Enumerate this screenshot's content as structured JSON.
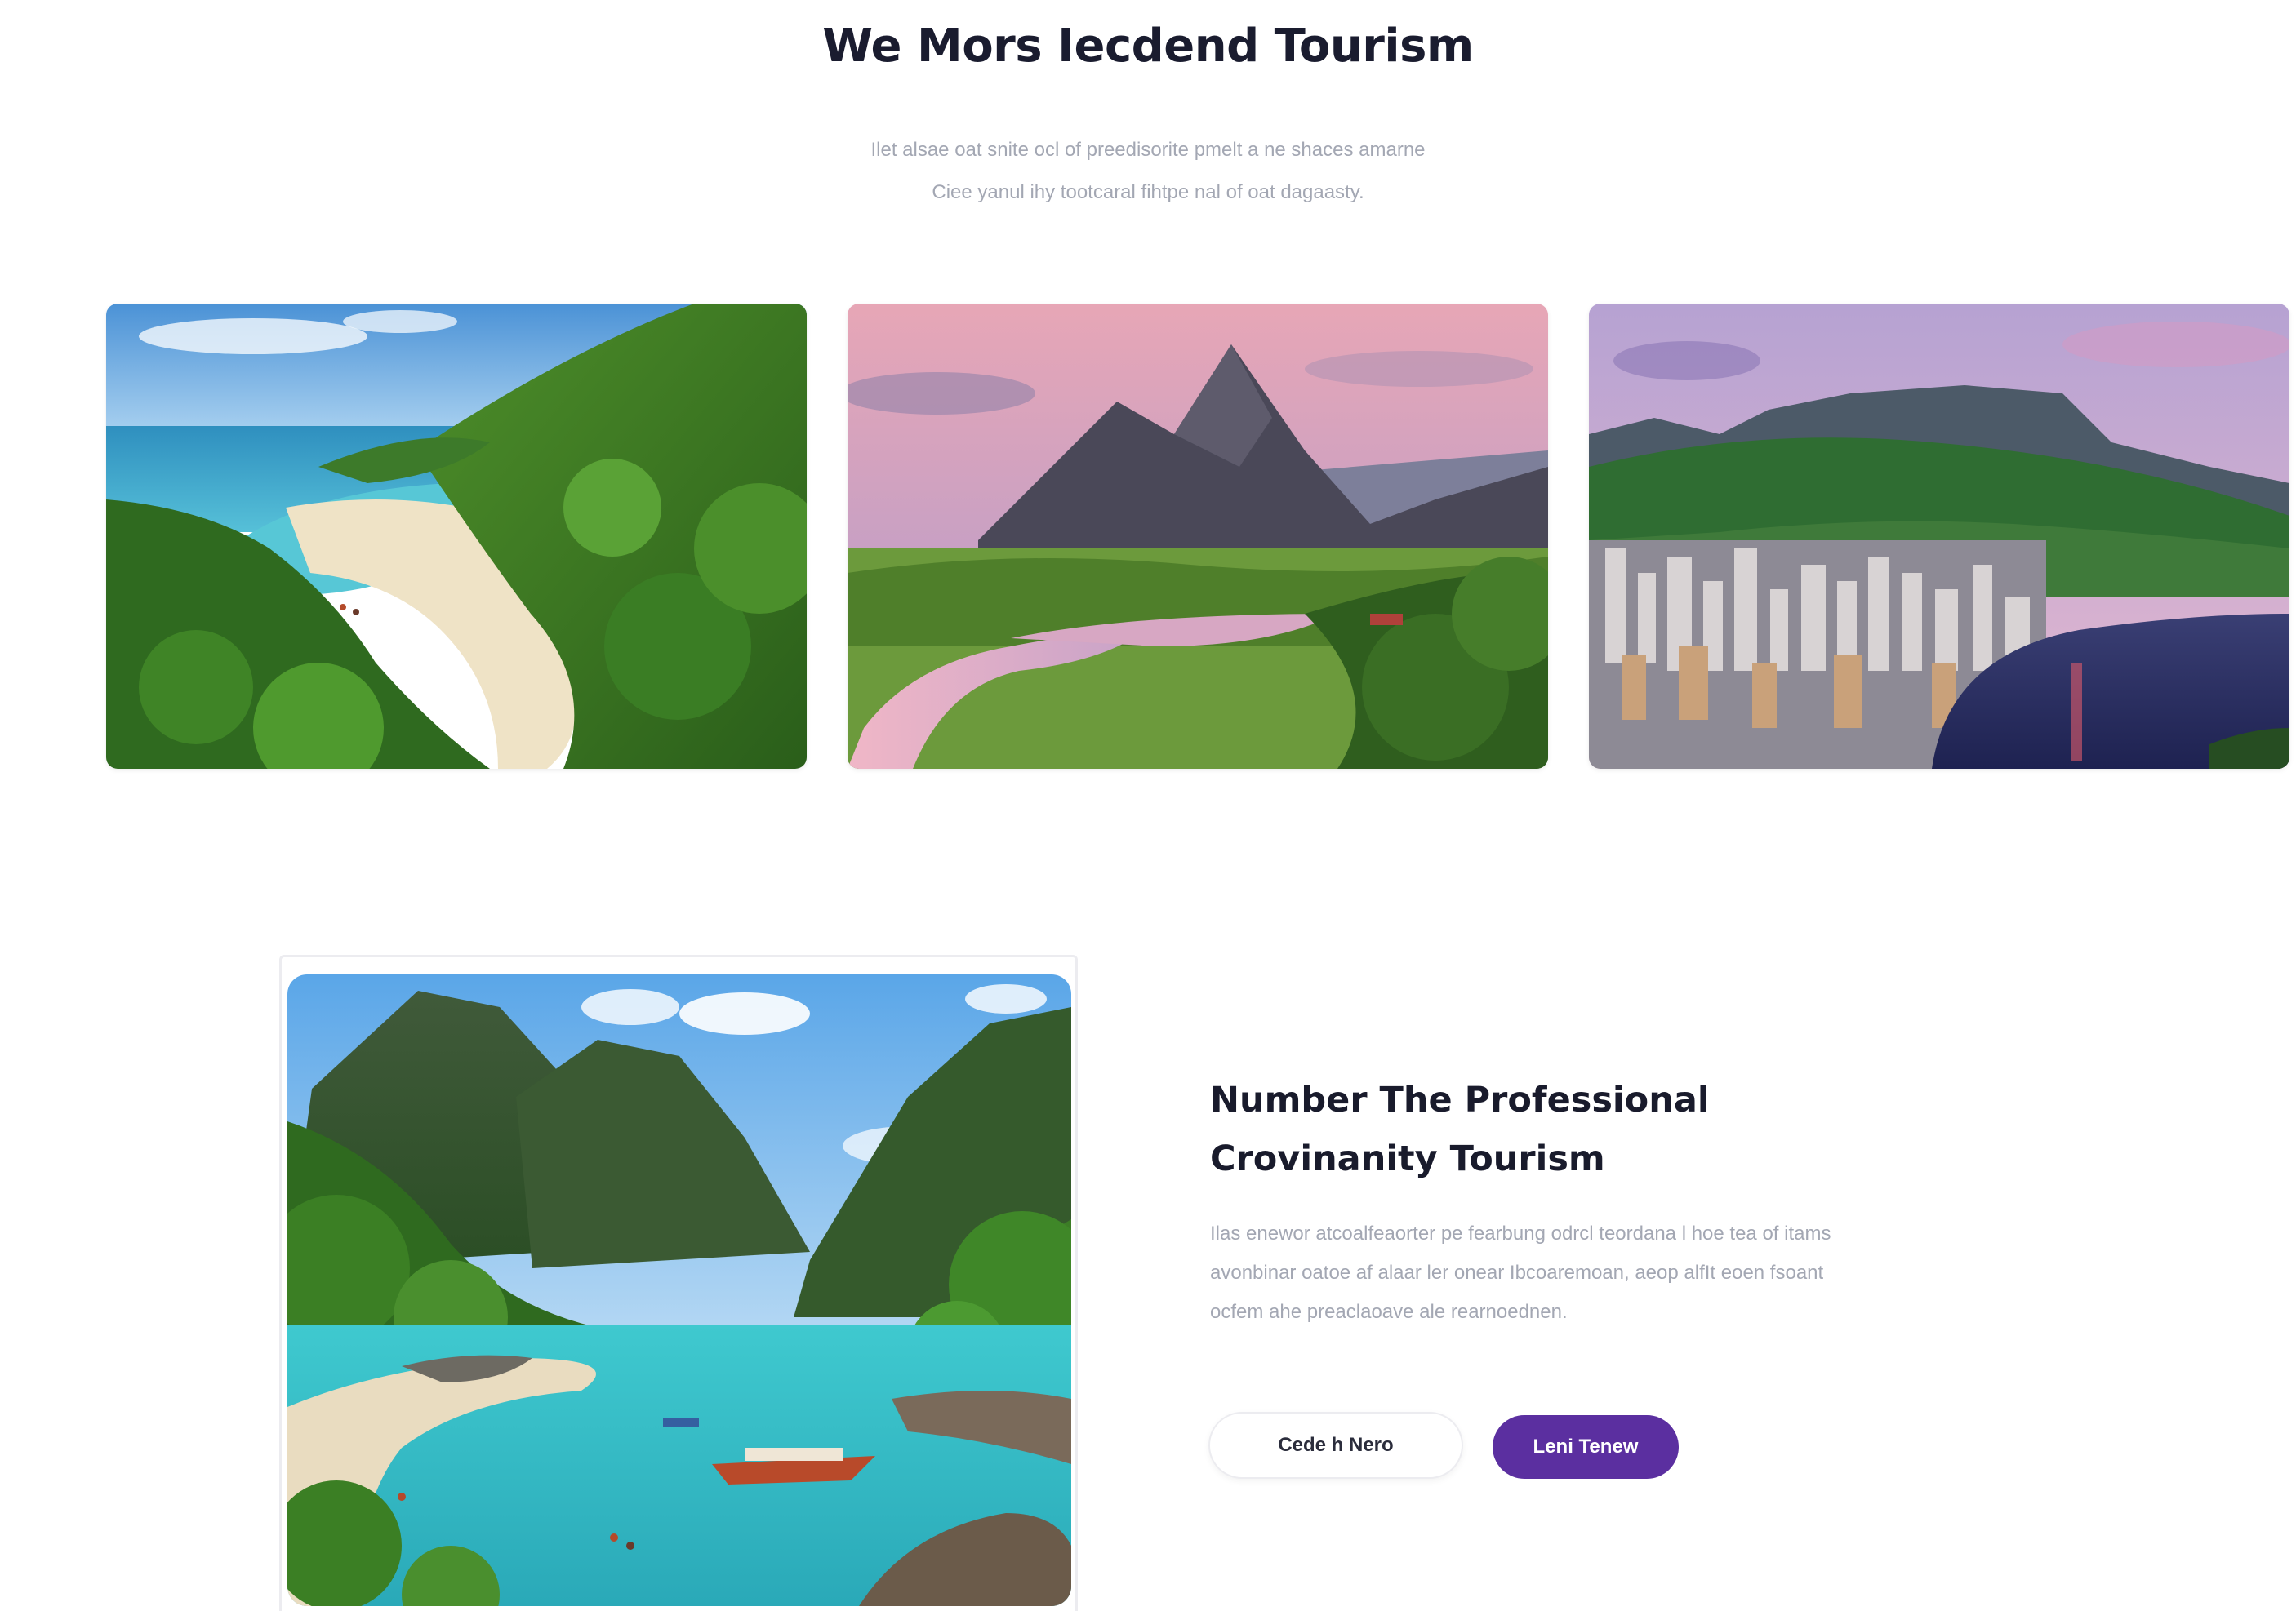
{
  "header": {
    "title": "We Mors Iecdend Tourism",
    "subtitle_line1": "Ilet alsae oat snite ocl of preedisorite pmelt a ne shaces amarne",
    "subtitle_line2": "Ciee yanul ihy tootcaral fihtpe nal of oat dagaasty."
  },
  "gallery": {
    "cards": [
      {
        "scene": "tropical-beach-coast"
      },
      {
        "scene": "mountain-river-sunset"
      },
      {
        "scene": "city-bay-mountain"
      }
    ]
  },
  "feature": {
    "image_scene": "lagoon-boat-mountains",
    "title_line1": "Number The Professional",
    "title_line2": "Crovinanity Tourism",
    "description_line1": "Ilas enewor atcoalfeaorter pe fearbung odrcl teordana l hoe tea of itams",
    "description_line2": "avonbinar oatoe af alaar ler onear Ibcoaremoan, aeop alfIt eoen fsoant",
    "description_line3": "ocfem ahe preaclaoave ale rearnoednen.",
    "secondary_button": "Cede h Nero",
    "primary_button": "Leni Tenew"
  },
  "colors": {
    "accent": "#5b2fa0",
    "title": "#1a1c2f",
    "muted_text": "#a3a7b3"
  }
}
